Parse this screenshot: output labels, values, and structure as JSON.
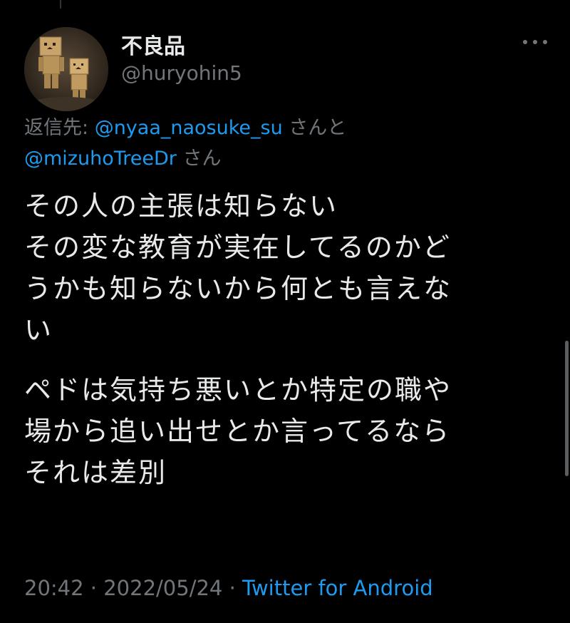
{
  "author": {
    "display_name": "不良品",
    "handle": "@huryohin5",
    "avatar_icon": "danbo-cardboard-robot-avatar"
  },
  "reply": {
    "prefix": "返信先: ",
    "mention_1": "@nyaa_naosuke_su",
    "joiner": " さんと",
    "mention_2": "@mizuhoTreeDr",
    "suffix": " さん"
  },
  "tweet": {
    "paragraphs": [
      {
        "lines": [
          "その人の主張は知らない",
          "その変な教育が実在してるのかど",
          "うかも知らないから何とも言えな",
          "い"
        ]
      },
      {
        "lines": [
          "ペドは気持ち悪いとか特定の職や",
          "場から追い出せとか言ってるなら",
          "それは差別"
        ]
      }
    ]
  },
  "meta": {
    "time": "20:42",
    "separator": " · ",
    "date": "2022/05/24",
    "source": "Twitter for Android"
  },
  "icons": {
    "more": "more-horizontal-icon"
  },
  "colors": {
    "background": "#000000",
    "text": "#e7e9ea",
    "secondary": "#71767b",
    "link": "#1d9bf0"
  }
}
